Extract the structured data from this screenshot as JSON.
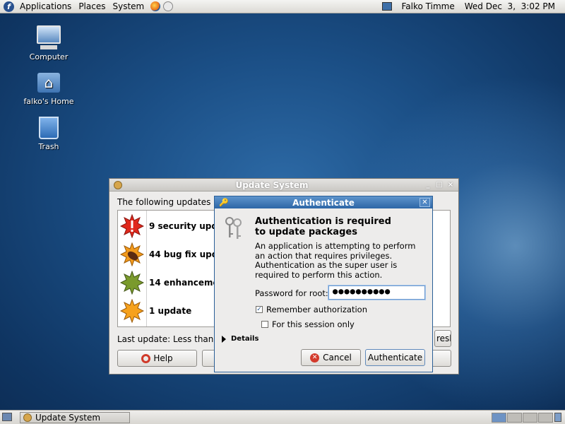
{
  "top_panel": {
    "menus": [
      "Applications",
      "Places",
      "System"
    ],
    "user": "Falko Timme",
    "clock": "Wed Dec  3,  3:02 PM"
  },
  "desktop_icons": [
    {
      "label": "Computer",
      "icon": "computer-icon"
    },
    {
      "label": "falko's Home",
      "icon": "home-folder-icon"
    },
    {
      "label": "Trash",
      "icon": "trash-icon"
    }
  ],
  "update_window": {
    "title": "Update System",
    "header": "The following updates are",
    "updates": [
      {
        "label": "9 security upda",
        "icon": "security-update-icon",
        "color": "#e0281c"
      },
      {
        "label": "44 bug fix upda",
        "icon": "bugfix-update-icon",
        "color": "#f29a1b"
      },
      {
        "label": "14 enhancemen",
        "icon": "enhancement-update-icon",
        "color": "#7a9a2c"
      },
      {
        "label": "1 update",
        "icon": "normal-update-icon",
        "color": "#f6a11c"
      }
    ],
    "last_update": "Last update:  Less than an",
    "refresh_label": "resh",
    "help_label": "Help"
  },
  "auth_dialog": {
    "title": "Authenticate",
    "heading_line1": "Authentication is required",
    "heading_line2": "to update packages",
    "body": "An application is attempting to perform an action that requires privileges. Authentication as the super user is required to perform this action.",
    "password_label": "Password for root:",
    "password_value": "●●●●●●●●●●",
    "remember_label": "Remember authorization",
    "remember_checked": true,
    "session_label": "For this session only",
    "session_checked": false,
    "details_label": "Details",
    "cancel_label": "Cancel",
    "authenticate_label": "Authenticate"
  },
  "bottom_panel": {
    "task_label": "Update System"
  }
}
